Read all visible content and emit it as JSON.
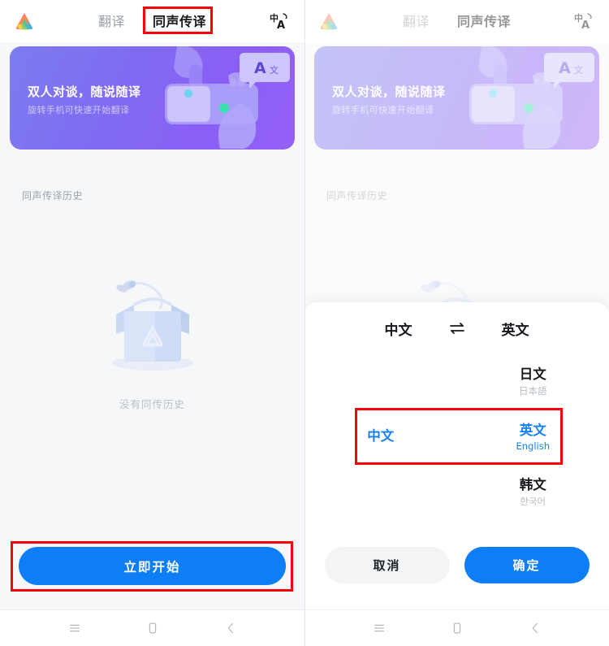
{
  "header": {
    "logo_icon": "app-logo-icon",
    "tabs": [
      {
        "label": "翻译",
        "active": false
      },
      {
        "label": "同声传译",
        "active": true
      }
    ],
    "action_icon": "translate-language-icon"
  },
  "banner": {
    "title": "双人对谈，随说随译",
    "subtitle": "旋转手机可快速开始翻译",
    "bubble_text": "A",
    "bubble_sub": "文",
    "gradient_from": "#7d7cf0",
    "gradient_to": "#9560f7"
  },
  "history": {
    "section_label": "同声传译历史",
    "empty_text": "没有同传历史",
    "empty_illustration": "empty-box-icon"
  },
  "primary_action": {
    "label": "立即开始",
    "color": "#0e7ef7"
  },
  "dialog": {
    "source_language": "中文",
    "swap_icon": "swap-arrows-icon",
    "target_language": "英文",
    "left_options": [
      {
        "name": "",
        "native": "",
        "selected": false
      },
      {
        "name": "中文",
        "native": "",
        "selected": true
      },
      {
        "name": "",
        "native": "",
        "selected": false
      }
    ],
    "right_options": [
      {
        "name": "日文",
        "native": "日本語",
        "selected": false
      },
      {
        "name": "英文",
        "native": "English",
        "selected": true
      },
      {
        "name": "韩文",
        "native": "한국어",
        "selected": false
      }
    ],
    "cancel_label": "取消",
    "confirm_label": "确定"
  },
  "navbar": {
    "menu_icon": "menu-recents-icon",
    "home_icon": "home-square-icon",
    "back_icon": "back-chevron-icon"
  },
  "annotations": {
    "highlight_color": "#fb0007",
    "boxes": [
      "active-tab-highlight",
      "start-button-highlight",
      "selected-language-row-highlight"
    ]
  }
}
